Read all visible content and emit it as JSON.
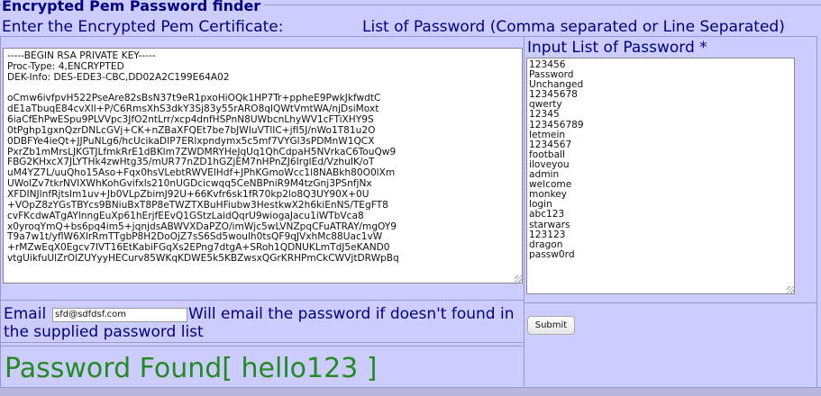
{
  "title": "Encrypted Pem Password finder",
  "header": {
    "left_label": "Enter the Encrypted Pem Certificate:",
    "right_label": "List of Password (Comma separated or Line Separated)"
  },
  "pem": {
    "value": "-----BEGIN RSA PRIVATE KEY-----\nProc-Type: 4,ENCRYPTED\nDEK-Info: DES-EDE3-CBC,DD02A2C199E64A02\n\noCmw6ivfpvH522PseAre82sBsN37t9eR1pxoHiOQk1HP7Tr+ppheE9PwkJkfwdtC\ndE1aTbuqE84cvXll+P/C6RmsXhS3dkY3Sj83y55rARO8qlQWtVmtWA/njDsiMoxt\n6iaCfEhPwESpu9PLVVpc3JfO2ntLrr/xcp4dnfHSPnN8UWbcnLhyWV1cFTiXHY9S\n0tPghp1gxnQzrDNLcGVj+CK+nZBaXFQEt7be7bJWIuVTlIC+jfI5J/nWo1T81u2O\n0DBFYe4ieQt+JJPuNLg6/hcUcikaDIP7ERlxpndymx5c5mf7VYGl3sPDMnW1QCX\nPxrZb1mMrsLJKGTJLfmkRrE1dBKlm7ZWDMRYHeJqUq1QhCdpaH5NVrkaC6TouQw9\nFBG2KHxcX7JLYTHk4zwHtg35/mUR77nZD1hGZjEM7nHPnZJ6IrglEd/VzhuIK/oT\nuM4YZ7L/uuQho15Aso+Fqx0hsVLebtRWVElHdf+JPhKGmoWcc1l8NABkh80O0lXm\nUWolZv7tkrNVIXWhKohGvifxls210nUGDcicwqq5CeNBPniR9M4tzGnj3PSnfjNx\nXFDINJlnfRjtslm1uv+Jb0VLpZbimJ92U+66Kvfr6sk1fR70kp2lo8Q3UY90X+0U\n+VOpZ8zYGsTBYcs9BNiuBxT8P8eTWZTXBuHFiubw3HestkwX2h6kiEnNS/TEgFT8\ncvFKcdwATgAYlnngEuXp61hErjfEEvQ1GStzLaidQqrU9wiogaJacu1iWTbVca8\nx0yroqYmQ+bs6pq4im5+jqnjdsABWVXDaPZO/imWjc5wLVNZpqCFuATRAY/mgOY9\nT9a7w1t/yflW6XlrRmTTgbP8H2DoOjZ7sS6Sd5woulh0tsQF9qJVxhMc88Uac1vW\n+rMZwEqX0Egcv7lVT16EtKabiFGqXs2EPng7dtgA+SRoh1QDNUKLmTdJ5eKAND0\nvtgUikfuUlZrOlZUYyyHECurv85WKqKDWE5k5KBZwsxQGrKRHPmCkCWVjtDRWpBq"
  },
  "passwords": {
    "label": "Input List of Password *",
    "value": "123456\nPassword\nUnchanged\n12345678\nqwerty\n12345\n123456789\nletmein\n1234567\nfootball\niloveyou\nadmin\nwelcome\nmonkey\nlogin\nabc123\nstarwars\n123123\ndragon\npassw0rd"
  },
  "email": {
    "label": "Email",
    "value": "sfd@sdfdsf.com",
    "note": "Will email the password if doesn't found in the supplied password list"
  },
  "submit_label": "Submit",
  "result": "Password Found[ hello123 ]"
}
